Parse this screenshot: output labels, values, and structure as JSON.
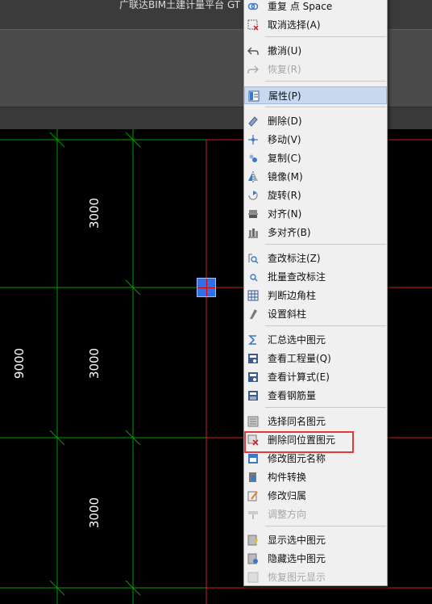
{
  "window": {
    "title": "广联达BIM土建计量平台 GT"
  },
  "drawing": {
    "dims": [
      "3000",
      "9000",
      "3000",
      "3000"
    ],
    "colors": {
      "axis": "#00a000",
      "red": "#d02020",
      "grip": "#2f6fe8"
    }
  },
  "menu": {
    "items": [
      {
        "label": "重复 点    Space",
        "icon": "repeat-icon"
      },
      {
        "label": "取消选择(A)",
        "icon": "deselect-icon"
      },
      {
        "label": "撤消(U)",
        "icon": "undo-icon"
      },
      {
        "label": "恢复(R)",
        "icon": "redo-icon",
        "disabled": true
      },
      {
        "label": "属性(P)",
        "icon": "properties-icon",
        "selected": true
      },
      {
        "label": "删除(D)",
        "icon": "eraser-icon"
      },
      {
        "label": "移动(V)",
        "icon": "move-icon"
      },
      {
        "label": "复制(C)",
        "icon": "copy-icon"
      },
      {
        "label": "镜像(M)",
        "icon": "mirror-icon"
      },
      {
        "label": "旋转(R)",
        "icon": "rotate-icon"
      },
      {
        "label": "对齐(N)",
        "icon": "align-icon"
      },
      {
        "label": "多对齐(B)",
        "icon": "multi-align-icon"
      },
      {
        "label": "查改标注(Z)",
        "icon": "edit-annotation-icon"
      },
      {
        "label": "批量查改标注",
        "icon": "batch-annotation-icon"
      },
      {
        "label": "判断边角柱",
        "icon": "corner-column-icon"
      },
      {
        "label": "设置斜柱",
        "icon": "slant-column-icon"
      },
      {
        "label": "汇总选中图元",
        "icon": "sigma-icon"
      },
      {
        "label": "查看工程量(Q)",
        "icon": "quantity-icon"
      },
      {
        "label": "查看计算式(E)",
        "icon": "formula-icon"
      },
      {
        "label": "查看钢筋量",
        "icon": "rebar-icon"
      },
      {
        "label": "选择同名图元",
        "icon": "same-name-icon"
      },
      {
        "label": "删除同位置图元",
        "icon": "delete-same-position-icon"
      },
      {
        "label": "修改图元名称",
        "icon": "rename-icon"
      },
      {
        "label": "构件转换",
        "icon": "convert-icon"
      },
      {
        "label": "修改归属",
        "icon": "ownership-icon"
      },
      {
        "label": "调整方向",
        "icon": "direction-icon",
        "disabled": true
      },
      {
        "label": "显示选中图元",
        "icon": "show-element-icon"
      },
      {
        "label": "隐藏选中图元",
        "icon": "hide-element-icon"
      },
      {
        "label": "恢复图元显示",
        "icon": "restore-display-icon",
        "disabled": true
      }
    ],
    "highlight_label": "删除同位置图元",
    "colors": {
      "selected_bg": "#c8d9ef",
      "highlight_box": "#e23a3a",
      "text": "#111111",
      "disabled": "#a6a6a6"
    }
  }
}
